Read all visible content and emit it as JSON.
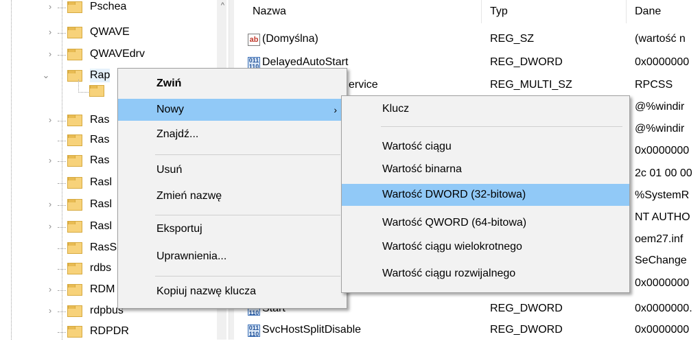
{
  "tree": {
    "items": [
      {
        "label": "Pschea",
        "expanded": false
      },
      {
        "label": "QWAVE",
        "expanded": false
      },
      {
        "label": "QWAVEdrv",
        "expanded": false
      },
      {
        "label": "Rap",
        "expanded": true
      },
      {
        "label": "",
        "expanded": false
      },
      {
        "label": "Ras",
        "expanded": false
      },
      {
        "label": "Ras",
        "expanded": false
      },
      {
        "label": "Ras",
        "expanded": false
      },
      {
        "label": "Rasl",
        "expanded": false
      },
      {
        "label": "Rasl",
        "expanded": false
      },
      {
        "label": "Rasl",
        "expanded": false
      },
      {
        "label": "RasS",
        "expanded": false
      },
      {
        "label": "rdbs",
        "expanded": false
      },
      {
        "label": "RDM",
        "expanded": false
      },
      {
        "label": "rdpbus",
        "expanded": false
      },
      {
        "label": "RDPDR",
        "expanded": false
      }
    ]
  },
  "list": {
    "columns": {
      "name": "Nazwa",
      "type": "Typ",
      "data": "Dane"
    },
    "rows": [
      {
        "name": "(Domyślna)",
        "type": "REG_SZ",
        "data": "(wartość n",
        "icon": "string-value-icon"
      },
      {
        "name": "DelayedAutoStart",
        "type": "REG_DWORD",
        "data": "0x0000000",
        "icon": "binary-value-icon"
      },
      {
        "name": "ervice",
        "type": "REG_MULTI_SZ",
        "data": "RPCSS",
        "icon": ""
      },
      {
        "name": "",
        "type": "",
        "data": "@%windir",
        "icon": ""
      },
      {
        "name": "",
        "type": "",
        "data": "@%windir",
        "icon": ""
      },
      {
        "name": "",
        "type": "",
        "data": "0x0000000",
        "icon": ""
      },
      {
        "name": "",
        "type": "",
        "data": "2c 01 00 00",
        "icon": ""
      },
      {
        "name": "",
        "type": "",
        "data": "%SystemR",
        "icon": ""
      },
      {
        "name": "",
        "type": "",
        "data": "NT AUTHO",
        "icon": ""
      },
      {
        "name": "",
        "type": "",
        "data": "oem27.inf",
        "icon": ""
      },
      {
        "name": "",
        "type": "",
        "data": "SeChange",
        "icon": ""
      },
      {
        "name": "e",
        "type": "REG_DWORD",
        "data": "0x0000000",
        "icon": ""
      },
      {
        "name": "Start",
        "type": "REG_DWORD",
        "data": "0x0000000.",
        "icon": "binary-value-icon"
      },
      {
        "name": "SvcHostSplitDisable",
        "type": "REG_DWORD",
        "data": "0x0000000",
        "icon": "binary-value-icon"
      }
    ]
  },
  "context_menu": {
    "items": [
      {
        "label": "Zwiń",
        "bold": true
      },
      {
        "label": "Nowy",
        "highlighted": true,
        "submenu": true
      },
      {
        "label": "Znajdź..."
      },
      {
        "label": "Usuń"
      },
      {
        "label": "Zmień nazwę"
      },
      {
        "label": "Eksportuj"
      },
      {
        "label": "Uprawnienia..."
      },
      {
        "label": "Kopiuj nazwę klucza"
      }
    ]
  },
  "submenu": {
    "items": [
      {
        "label": "Klucz"
      },
      {
        "label": "Wartość ciągu"
      },
      {
        "label": "Wartość binarna"
      },
      {
        "label": "Wartość DWORD (32-bitowa)",
        "highlighted": true
      },
      {
        "label": "Wartość QWORD (64-bitowa)"
      },
      {
        "label": "Wartość ciągu wielokrotnego"
      },
      {
        "label": "Wartość ciągu rozwijalnego"
      }
    ]
  },
  "icons": {
    "string_value": "ab",
    "binary_value": "011\n110",
    "chevron_right": "›",
    "chevron_down": "⌄",
    "submenu_arrow": "›",
    "scroll_up": "^"
  },
  "colors": {
    "menu_highlight": "#91c9f7",
    "menu_background": "#f2f2f2",
    "folder": "#f7d27a"
  }
}
